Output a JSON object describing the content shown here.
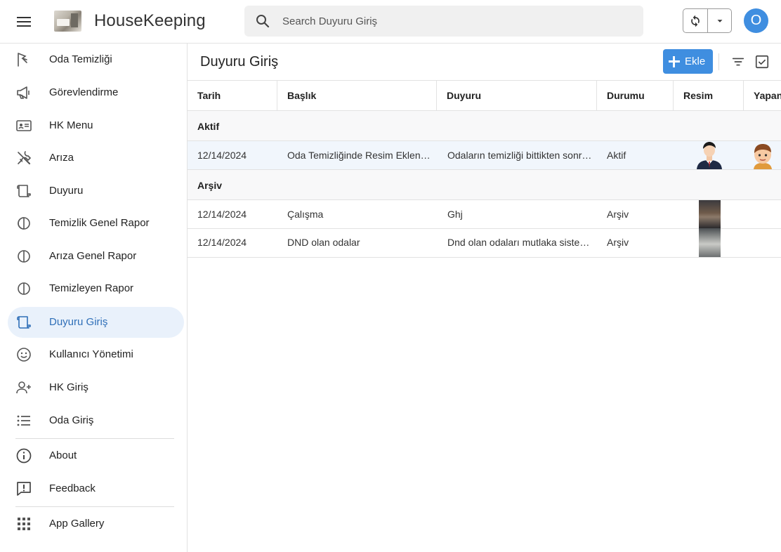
{
  "app": {
    "title": "HouseKeeping",
    "search_placeholder": "Search Duyuru Giriş",
    "avatar_letter": "O",
    "accent": "#3f8ee0"
  },
  "sidebar": {
    "items": [
      {
        "label": "Oda Temizliği",
        "icon": "brush-icon"
      },
      {
        "label": "Görevlendirme",
        "icon": "megaphone-icon"
      },
      {
        "label": "HK Menu",
        "icon": "id-card-icon"
      },
      {
        "label": "Arıza",
        "icon": "tools-icon"
      },
      {
        "label": "Duyuru",
        "icon": "scroll-icon"
      },
      {
        "label": "Temizlik Genel Rapor",
        "icon": "half-circle-icon"
      },
      {
        "label": "Arıza Genel Rapor",
        "icon": "half-circle-icon"
      },
      {
        "label": "Temizleyen Rapor",
        "icon": "half-circle-icon"
      },
      {
        "label": "Duyuru Giriş",
        "icon": "scroll-icon",
        "active": true
      },
      {
        "label": "Kullanıcı Yönetimi",
        "icon": "smiley-icon"
      },
      {
        "label": "HK Giriş",
        "icon": "person-add-icon"
      },
      {
        "label": "Oda Giriş",
        "icon": "list-icon"
      }
    ],
    "footer": [
      {
        "label": "About",
        "icon": "info-icon"
      },
      {
        "label": "Feedback",
        "icon": "feedback-icon"
      }
    ],
    "gallery": {
      "label": "App Gallery",
      "icon": "grid-icon"
    }
  },
  "main": {
    "title": "Duyuru Giriş",
    "add_label": "Ekle",
    "columns": [
      "Tarih",
      "Başlık",
      "Duyuru",
      "Durumu",
      "Resim",
      "Yapan"
    ],
    "groups": [
      {
        "label": "Aktif",
        "rows": [
          {
            "tarih": "12/14/2024",
            "baslik": "Oda Temizliğinde Resim Eklenmesi",
            "duyuru": "Odaların temizliği bittikten sonra resim eklenmesi",
            "durumu": "Aktif",
            "resim": "businessman-avatar",
            "yapan": "boy-avatar"
          }
        ]
      },
      {
        "label": "Arşiv",
        "rows": [
          {
            "tarih": "12/14/2024",
            "baslik": "Çalışma",
            "duyuru": "Ghj",
            "durumu": "Arşiv",
            "resim": "room-photo"
          },
          {
            "tarih": "12/14/2024",
            "baslik": "DND olan odalar",
            "duyuru": "Dnd olan odaları mutlaka sisteme girin",
            "durumu": "Arşiv",
            "resim": "room-photo"
          }
        ]
      }
    ]
  }
}
